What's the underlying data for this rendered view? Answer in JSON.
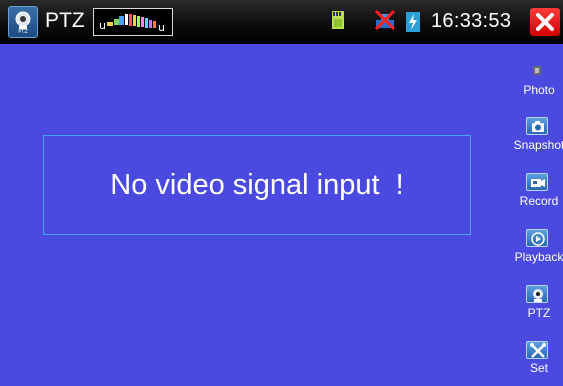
{
  "header": {
    "mode_title": "PTZ",
    "time": "16:33:53"
  },
  "main": {
    "message": "No video signal input  !"
  },
  "sidebar": {
    "items": [
      {
        "label": "Photo",
        "icon": "photo-icon"
      },
      {
        "label": "Snapshot",
        "icon": "camera-icon"
      },
      {
        "label": "Record",
        "icon": "record-icon"
      },
      {
        "label": "Playback",
        "icon": "playback-icon"
      },
      {
        "label": "PTZ",
        "icon": "ptz-camera-icon"
      },
      {
        "label": "Set",
        "icon": "tools-icon"
      }
    ]
  },
  "colors": {
    "background": "#4a4ae0",
    "close_button": "#e00000",
    "message_border": "#4aa0ff"
  }
}
